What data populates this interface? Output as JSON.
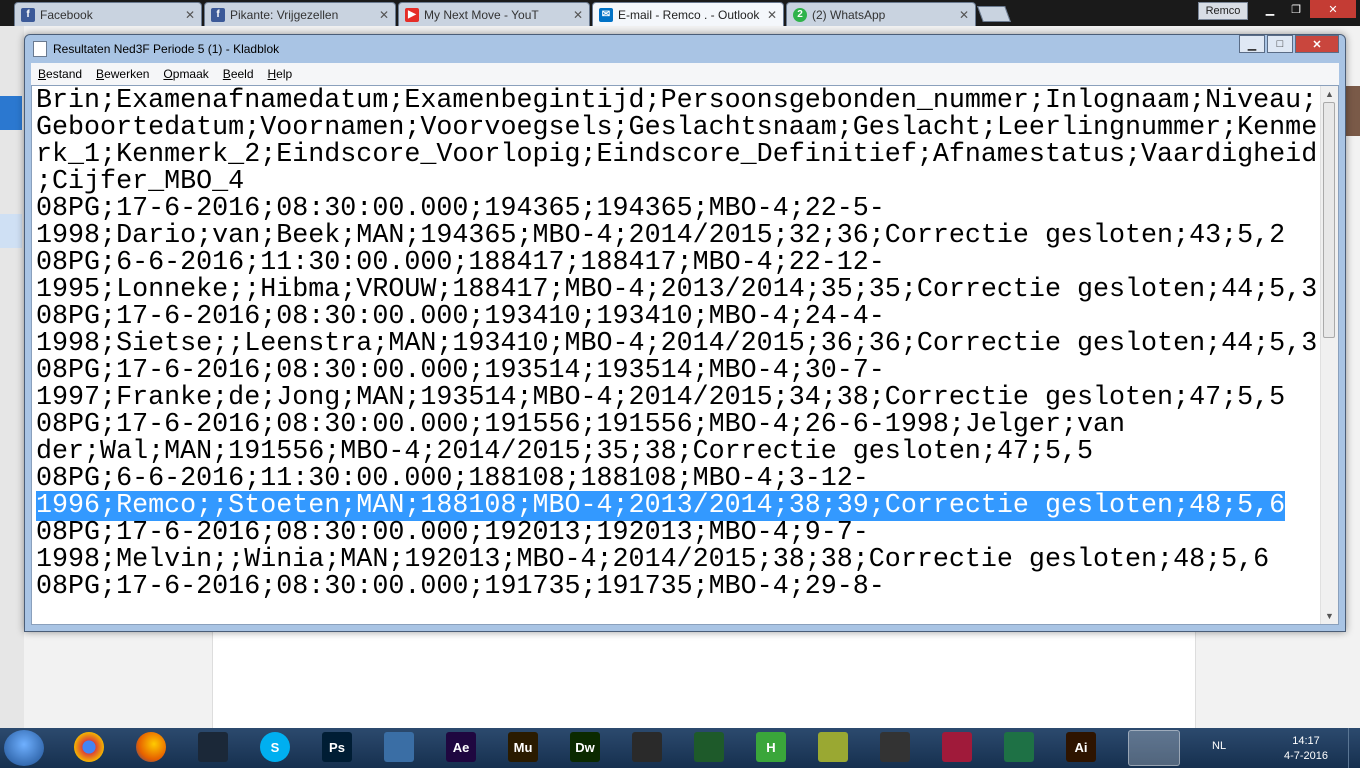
{
  "browser": {
    "tabs": [
      {
        "title": "Facebook",
        "icon": "facebook-icon",
        "color": "#3b5998"
      },
      {
        "title": "Pikante: Vrijgezellen",
        "icon": "facebook-icon",
        "color": "#3b5998"
      },
      {
        "title": "My Next Move - YouT",
        "icon": "youtube-icon",
        "color": "#e52d27"
      },
      {
        "title": "E-mail - Remco . - Outlook",
        "icon": "mail-icon",
        "color": "#0072c6"
      },
      {
        "title": "(2) WhatsApp",
        "icon": "whatsapp-icon",
        "color": "#2fb34a"
      }
    ],
    "user": "Remco"
  },
  "notepad": {
    "title": "Resultaten Ned3F Periode 5 (1) - Kladblok",
    "menu": [
      "Bestand",
      "Bewerken",
      "Opmaak",
      "Beeld",
      "Help"
    ],
    "lines": [
      "Brin;Examenafnamedatum;Examenbegintijd;Persoonsgebonden_nummer;Inlognaam;Niveau;",
      "Geboortedatum;Voornamen;Voorvoegsels;Geslachtsnaam;Geslacht;Leerlingnummer;Kenme",
      "rk_1;Kenmerk_2;Eindscore_Voorlopig;Eindscore_Definitief;Afnamestatus;Vaardigheid",
      ";Cijfer_MBO_4",
      "08PG;17-6-2016;08:30:00.000;194365;194365;MBO-4;22-5-",
      "1998;Dario;van;Beek;MAN;194365;MBO-4;2014/2015;32;36;Correctie gesloten;43;5,2",
      "08PG;6-6-2016;11:30:00.000;188417;188417;MBO-4;22-12-",
      "1995;Lonneke;;Hibma;VROUW;188417;MBO-4;2013/2014;35;35;Correctie gesloten;44;5,3",
      "08PG;17-6-2016;08:30:00.000;193410;193410;MBO-4;24-4-",
      "1998;Sietse;;Leenstra;MAN;193410;MBO-4;2014/2015;36;36;Correctie gesloten;44;5,3",
      "08PG;17-6-2016;08:30:00.000;193514;193514;MBO-4;30-7-",
      "1997;Franke;de;Jong;MAN;193514;MBO-4;2014/2015;34;38;Correctie gesloten;47;5,5",
      "08PG;17-6-2016;08:30:00.000;191556;191556;MBO-4;26-6-1998;Jelger;van",
      "der;Wal;MAN;191556;MBO-4;2014/2015;35;38;Correctie gesloten;47;5,5",
      "08PG;6-6-2016;11:30:00.000;188108;188108;MBO-4;3-12-",
      "1996;Remco;;Stoeten;MAN;188108;MBO-4;2013/2014;38;39;Correctie gesloten;48;5,6",
      "08PG;17-6-2016;08:30:00.000;192013;192013;MBO-4;9-7-",
      "1998;Melvin;;Winia;MAN;192013;MBO-4;2014/2015;38;38;Correctie gesloten;48;5,6",
      "08PG;17-6-2016;08:30:00.000;191735;191735;MBO-4;29-8-"
    ],
    "selected_line": 15
  },
  "taskbar": {
    "apps": [
      {
        "name": "chrome-icon",
        "label": "",
        "color": "#e8b21a"
      },
      {
        "name": "firefox-icon",
        "label": "",
        "color": "#e66000"
      },
      {
        "name": "steam-icon",
        "label": "",
        "color": "#1b2838"
      },
      {
        "name": "skype-icon",
        "label": "S",
        "color": "#00aff0"
      },
      {
        "name": "photoshop-icon",
        "label": "Ps",
        "color": "#001d34"
      },
      {
        "name": "keyboard-icon",
        "label": "",
        "color": "#3a6ea5"
      },
      {
        "name": "after-effects-icon",
        "label": "Ae",
        "color": "#1f0740"
      },
      {
        "name": "muse-icon",
        "label": "Mu",
        "color": "#2a1b00"
      },
      {
        "name": "dreamweaver-icon",
        "label": "Dw",
        "color": "#0b2a00"
      },
      {
        "name": "film-icon",
        "label": "",
        "color": "#2a2a2a"
      },
      {
        "name": "bank-icon",
        "label": "",
        "color": "#1e5a2a"
      },
      {
        "name": "hostname-icon",
        "label": "H",
        "color": "#3aa63a"
      },
      {
        "name": "notepad-plus-icon",
        "label": "",
        "color": "#9aa832"
      },
      {
        "name": "speedometer-icon",
        "label": "",
        "color": "#333333"
      },
      {
        "name": "game-icon",
        "label": "",
        "color": "#a01a3a"
      },
      {
        "name": "excel-icon",
        "label": "",
        "color": "#1e7145"
      },
      {
        "name": "illustrator-icon",
        "label": "Ai",
        "color": "#2e1400"
      }
    ],
    "language": "NL",
    "time": "14:17",
    "date": "4-7-2016"
  }
}
